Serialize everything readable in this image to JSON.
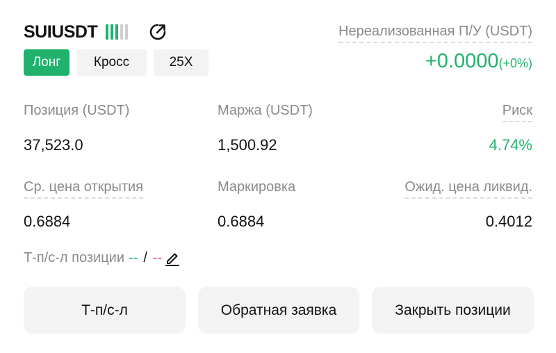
{
  "header": {
    "symbol": "SUIUSDT",
    "strength_bars": {
      "filled": 3,
      "total": 5
    },
    "side": "Лонг",
    "margin_mode": "Кросс",
    "leverage": "25X",
    "upl_label": "Нереализованная П/У (USDT)",
    "upl_value": "+0.0000",
    "upl_percent": "(+0%)"
  },
  "stats": {
    "position_label": "Позиция (USDT)",
    "position_value": "37,523.0",
    "margin_label": "Маржа (USDT)",
    "margin_value": "1,500.92",
    "risk_label": "Риск",
    "risk_value": "4.74%",
    "entry_label": "Ср. цена открытия",
    "entry_value": "0.6884",
    "mark_label": "Маркировка",
    "mark_value": "0.6884",
    "liq_label": "Ожид. цена ликвид.",
    "liq_value": "0.4012"
  },
  "tpsl": {
    "label": "Т-п/с-л позиции",
    "tp_value": "--",
    "separator": "/",
    "sl_value": "--"
  },
  "actions": {
    "tpsl_button": "Т-п/с-л",
    "reverse_button": "Обратная заявка",
    "close_button": "Закрыть позиции"
  },
  "icons": {
    "share": "share-icon",
    "edit": "pencil-icon"
  },
  "colors": {
    "profit": "#20b26c",
    "loss": "#e05565",
    "muted": "#8a8a8a",
    "button_bg": "#f3f3f3"
  }
}
